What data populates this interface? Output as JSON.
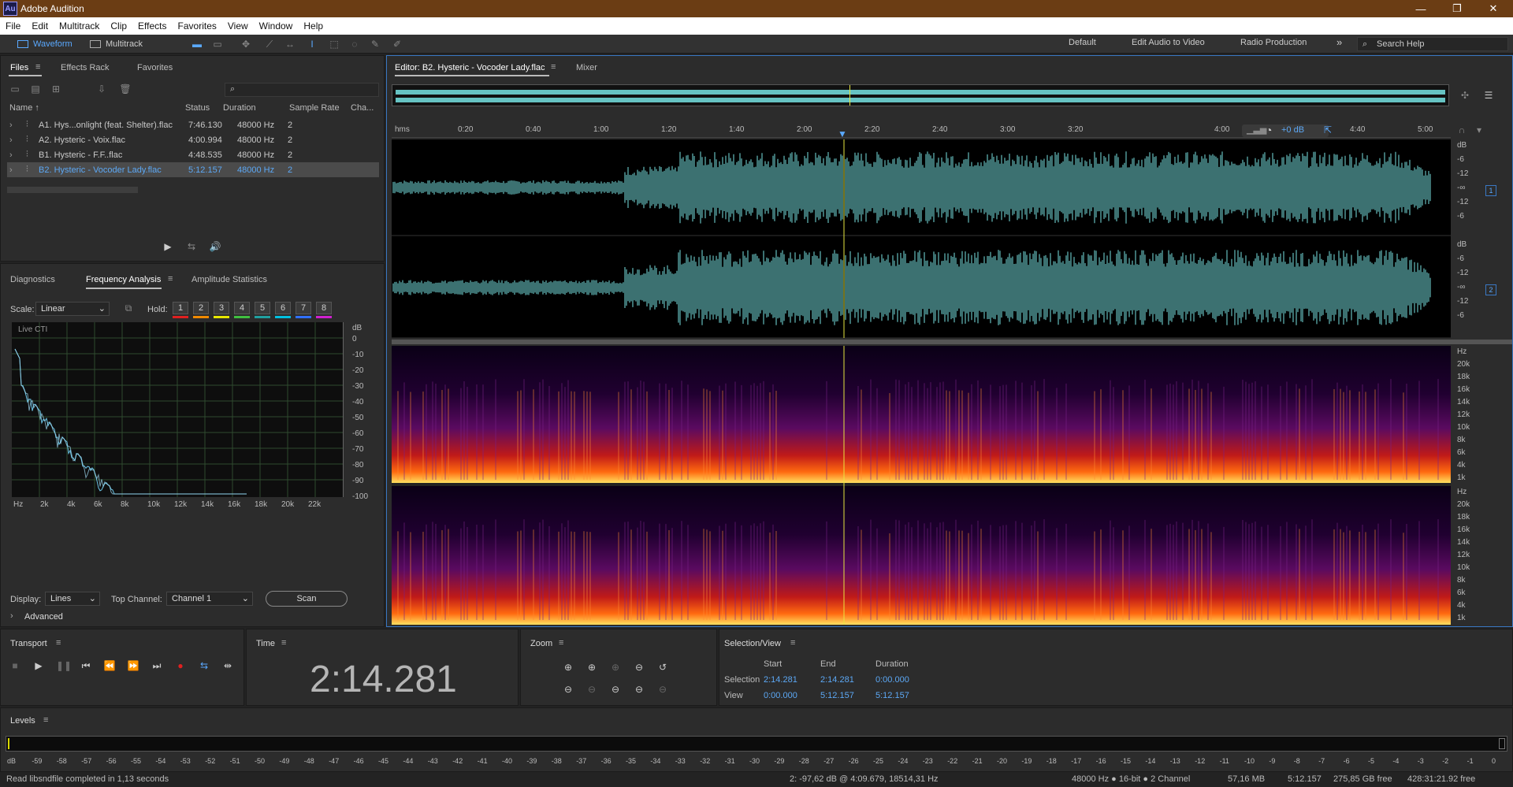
{
  "window": {
    "title": "Adobe Audition",
    "logo": "Au",
    "min": "—",
    "max": "❐",
    "close": "✕"
  },
  "menu": [
    "File",
    "Edit",
    "Multitrack",
    "Clip",
    "Effects",
    "Favorites",
    "View",
    "Window",
    "Help"
  ],
  "toolbar": {
    "waveform": "Waveform",
    "multitrack": "Multitrack",
    "workspaces": [
      "Default",
      "Edit Audio to Video",
      "Radio Production"
    ],
    "more": "»",
    "search_placeholder": "Search Help"
  },
  "files_panel": {
    "tabs": [
      "Files",
      "Effects Rack",
      "Favorites"
    ],
    "columns": [
      "Name ↑",
      "Status",
      "Duration",
      "Sample Rate",
      "Cha..."
    ],
    "rows": [
      {
        "name": "A1. Hys...onlight (feat. Shelter).flac",
        "duration": "7:46.130",
        "rate": "48000 Hz",
        "ch": "2"
      },
      {
        "name": "A2. Hysteric - Voix.flac",
        "duration": "4:00.994",
        "rate": "48000 Hz",
        "ch": "2"
      },
      {
        "name": "B1. Hysteric - F.F..flac",
        "duration": "4:48.535",
        "rate": "48000 Hz",
        "ch": "2"
      },
      {
        "name": "B2. Hysteric - Vocoder Lady.flac",
        "duration": "5:12.157",
        "rate": "48000 Hz",
        "ch": "2"
      }
    ],
    "selected": 3
  },
  "freq_panel": {
    "tabs": [
      "Diagnostics",
      "Frequency Analysis",
      "Amplitude Statistics"
    ],
    "scale_label": "Scale:",
    "scale": "Linear",
    "hold_label": "Hold:",
    "hold": [
      "1",
      "2",
      "3",
      "4",
      "5",
      "6",
      "7",
      "8"
    ],
    "hold_colors": [
      "#e02020",
      "#f08a00",
      "#e8e800",
      "#40c040",
      "#20a0a0",
      "#00c0e0",
      "#3070ff",
      "#d020d0"
    ],
    "live": "Live CTI",
    "db_unit": "dB",
    "db_ticks": [
      "0",
      "-10",
      "-20",
      "-30",
      "-40",
      "-50",
      "-60",
      "-70",
      "-80",
      "-90",
      "-100"
    ],
    "hz_ticks": [
      "Hz",
      "2k",
      "4k",
      "6k",
      "8k",
      "10k",
      "12k",
      "14k",
      "16k",
      "18k",
      "20k",
      "22k"
    ],
    "display_label": "Display:",
    "display": "Lines",
    "top_channel_label": "Top Channel:",
    "top_channel": "Channel 1",
    "scan": "Scan",
    "advanced": "Advanced"
  },
  "editor": {
    "tabs": [
      "Editor: B2. Hysteric - Vocoder Lady.flac",
      "Mixer"
    ],
    "ruler": [
      "hms",
      "0:20",
      "0:40",
      "1:00",
      "1:20",
      "1:40",
      "2:00",
      "2:20",
      "2:40",
      "3:00",
      "3:20",
      "4:00",
      "4:20",
      "4:40",
      "5:00"
    ],
    "gain": "+0 dB",
    "db_scale": [
      "dB",
      "-6",
      "-12",
      "-∞",
      "-12",
      "-6"
    ],
    "channels": [
      "1",
      "2"
    ],
    "hz_scale": [
      "Hz",
      "20k",
      "18k",
      "16k",
      "14k",
      "12k",
      "10k",
      "8k",
      "6k",
      "4k",
      "1k"
    ]
  },
  "transport": {
    "title": "Transport"
  },
  "time": {
    "title": "Time",
    "value": "2:14.281"
  },
  "zoom": {
    "title": "Zoom"
  },
  "selection": {
    "title": "Selection/View",
    "headers": [
      "Start",
      "End",
      "Duration"
    ],
    "selection_label": "Selection",
    "view_label": "View",
    "sel": [
      "2:14.281",
      "2:14.281",
      "0:00.000"
    ],
    "view": [
      "0:00.000",
      "5:12.157",
      "5:12.157"
    ]
  },
  "levels": {
    "title": "Levels",
    "scale": [
      "dB",
      "-59",
      "-58",
      "-57",
      "-56",
      "-55",
      "-54",
      "-53",
      "-52",
      "-51",
      "-50",
      "-49",
      "-48",
      "-47",
      "-46",
      "-45",
      "-44",
      "-43",
      "-42",
      "-41",
      "-40",
      "-39",
      "-38",
      "-37",
      "-36",
      "-35",
      "-34",
      "-33",
      "-32",
      "-31",
      "-30",
      "-29",
      "-28",
      "-27",
      "-26",
      "-25",
      "-24",
      "-23",
      "-22",
      "-21",
      "-20",
      "-19",
      "-18",
      "-17",
      "-16",
      "-15",
      "-14",
      "-13",
      "-12",
      "-11",
      "-10",
      "-9",
      "-8",
      "-7",
      "-6",
      "-5",
      "-4",
      "-3",
      "-2",
      "-1",
      "0"
    ]
  },
  "status": {
    "left": "Read libsndfile completed in 1,13 seconds",
    "cursor": "2: -97,62 dB @ 4:09.679, 18514,31 Hz",
    "format": "48000 Hz ● 16-bit ● 2 Channel",
    "size": "57,16 MB",
    "duration": "5:12.157",
    "free": "275,85 GB free",
    "free_time": "428:31:21.92 free"
  }
}
